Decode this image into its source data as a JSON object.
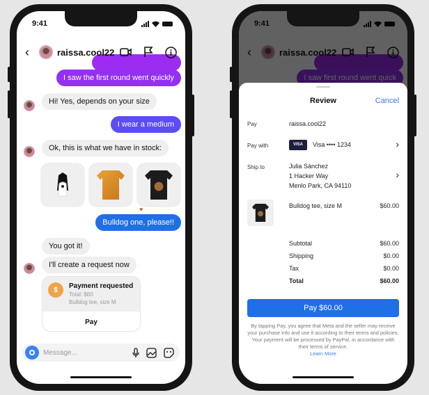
{
  "status_bar": {
    "time": "9:41"
  },
  "chat": {
    "contact_name": "raissa.cool22",
    "header_icons": [
      "video-call-icon",
      "flag-icon",
      "info-icon"
    ],
    "messages": [
      {
        "from": "me",
        "text": "I saw the first round went quickly"
      },
      {
        "from": "them",
        "text": "Hi! Yes, depends on your size"
      },
      {
        "from": "me",
        "text": "I wear a medium"
      },
      {
        "from": "them",
        "text": "Ok, this is what we have in stock:"
      },
      {
        "from": "me",
        "text": "Bulldog one, please!!"
      },
      {
        "from": "them",
        "text": "You got it!"
      },
      {
        "from": "them",
        "text": "I'll create a request now"
      }
    ],
    "products": [
      {
        "name": "Border collie tee",
        "color": "#f2f2f2"
      },
      {
        "name": "Golden retriever tee",
        "color": "#e59a2c"
      },
      {
        "name": "Bulldog tee",
        "color": "#1c1c1c"
      }
    ],
    "reaction": "heart",
    "payment_card": {
      "title": "Payment requested",
      "total": "Total: $60",
      "item": "Bulldog tee, size M",
      "button": "Pay"
    },
    "composer": {
      "placeholder": "Message..."
    }
  },
  "review": {
    "chat_preview": "I saw first round went quick",
    "title": "Review",
    "cancel": "Cancel",
    "pay_label": "Pay",
    "pay_value": "raissa.cool22",
    "pay_with_label": "Pay with",
    "card_brand": "VISA",
    "card_text": "Visa •••• 1234",
    "ship_to_label": "Ship to",
    "ship_name": "Julia Sánchez",
    "ship_line1": "1 Hacker Way",
    "ship_line2": "Menlo Park, CA 94110",
    "item_name": "Bulldog tee, size M",
    "item_price": "$60.00",
    "subtotal_label": "Subtotal",
    "subtotal": "$60.00",
    "shipping_label": "Shipping",
    "shipping": "$0.00",
    "tax_label": "Tax",
    "tax": "$0.00",
    "total_label": "Total",
    "total": "$60.00",
    "pay_button": "Pay $60.00",
    "legal": "By tapping Pay, you agree that Meta and the seller may receive your purchase info and use it according to their terms and policies. Your payment will be processed by PayPal, in accordance with their terms of service.",
    "learn_more": "Learn More"
  },
  "colors": {
    "gradient_top": "#9b2cf0",
    "gradient_mid": "#5b4cf5",
    "gradient_bottom": "#1f6fe6",
    "pay_button": "#1f6fe6",
    "link": "#3b7ae8"
  }
}
